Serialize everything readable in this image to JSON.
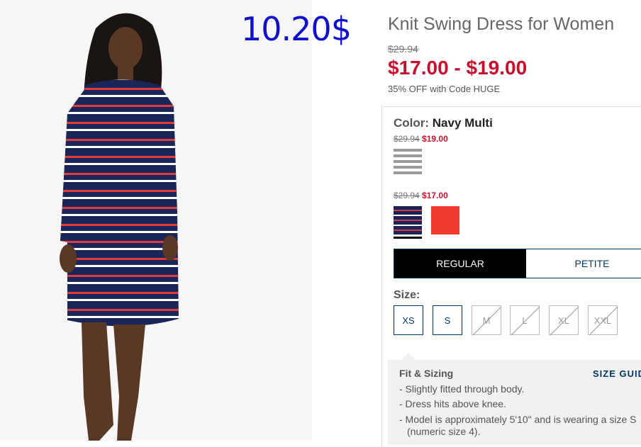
{
  "overlay_price": "10.20$",
  "product": {
    "title": "Knit Swing Dress for Women",
    "original_price": "$29.94",
    "price_range": "$17.00 - $19.00",
    "promo": "35% OFF with Code HUGE"
  },
  "color": {
    "label": "Color:",
    "selected": "Navy Multi",
    "groups": [
      {
        "original": "$29.94",
        "sale": "$19.00",
        "swatches": [
          "grey-stripe"
        ]
      },
      {
        "original": "$29.94",
        "sale": "$17.00",
        "swatches": [
          "navy-multi-stripe",
          "red-solid"
        ]
      }
    ]
  },
  "fit_tabs": [
    {
      "label": "REGULAR",
      "active": true
    },
    {
      "label": "PETITE",
      "active": false
    }
  ],
  "size": {
    "label": "Size:",
    "options": [
      {
        "label": "XS",
        "available": true
      },
      {
        "label": "S",
        "available": true
      },
      {
        "label": "M",
        "available": false
      },
      {
        "label": "L",
        "available": false
      },
      {
        "label": "XL",
        "available": false
      },
      {
        "label": "XXL",
        "available": false
      }
    ]
  },
  "fit_sizing": {
    "heading": "Fit & Sizing",
    "size_guide": "SIZE GUID",
    "bullets": [
      "- Slightly fitted through body.",
      "- Dress hits above knee.",
      "- Model is approximately 5'10\" and is wearing a size S",
      "(numeric size 4)."
    ]
  },
  "colors": {
    "sale": "#c8102e",
    "link": "#003764",
    "overlay": "#1010cc"
  }
}
